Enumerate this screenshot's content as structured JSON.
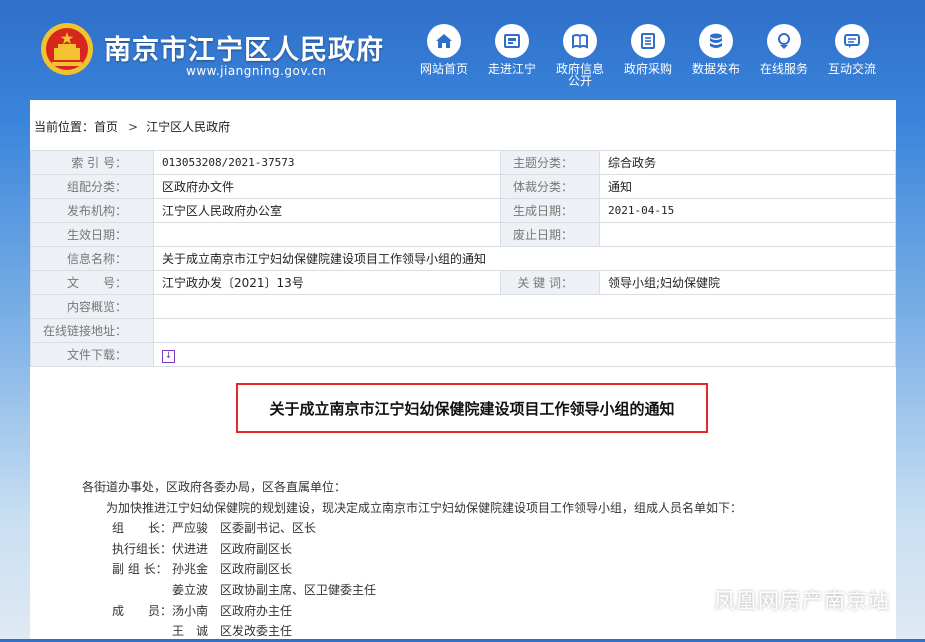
{
  "header": {
    "site_title": "南京市江宁区人民政府",
    "site_url": "www.jiangning.gov.cn",
    "nav": [
      {
        "label": "网站首页",
        "icon": "home-icon"
      },
      {
        "label": "走进江宁",
        "icon": "building-icon"
      },
      {
        "label": "政府信息公开",
        "icon": "book-icon"
      },
      {
        "label": "政府采购",
        "icon": "list-icon"
      },
      {
        "label": "数据发布",
        "icon": "database-icon"
      },
      {
        "label": "在线服务",
        "icon": "service-icon"
      },
      {
        "label": "互动交流",
        "icon": "chat-icon"
      }
    ]
  },
  "breadcrumb": {
    "prefix": "当前位置：",
    "home": "首页",
    "separator": ">",
    "current": "江宁区人民政府"
  },
  "meta": {
    "index_label": "索 引 号：",
    "index_value": "013053208/2021-37573",
    "topic_label": "主题分类：",
    "topic_value": "综合政务",
    "group_label": "组配分类：",
    "group_value": "区政府办文件",
    "genre_label": "体裁分类：",
    "genre_value": "通知",
    "issuer_label": "发布机构：",
    "issuer_value": "江宁区人民政府办公室",
    "date_label": "生成日期：",
    "date_value": "2021-04-15",
    "effective_label": "生效日期：",
    "effective_value": "",
    "abolish_label": "废止日期：",
    "abolish_value": "",
    "name_label": "信息名称：",
    "name_value": "关于成立南京市江宁妇幼保健院建设项目工作领导小组的通知",
    "docno_label": "文　　号：",
    "docno_value": "江宁政办发〔2021〕13号",
    "keyword_label": "关 键 词：",
    "keyword_value": "领导小组;妇幼保健院",
    "summary_label": "内容概览：",
    "summary_value": "",
    "link_label": "在线链接地址：",
    "link_value": "",
    "download_label": "文件下载：",
    "download_icon": "download-icon"
  },
  "notice": {
    "title": "关于成立南京市江宁妇幼保健院建设项目工作领导小组的通知",
    "salutation": "各街道办事处，区政府各委办局，区各直属单位：",
    "intro": "为加快推进江宁妇幼保健院的规划建设，现决定成立南京市江宁妇幼保健院建设项目工作领导小组，组成人员名单如下：",
    "members": [
      {
        "role": "组　　长：",
        "name": "严应骏　区委副书记、区长"
      },
      {
        "role": "执行组长：",
        "name": "伏进进　区政府副区长"
      },
      {
        "role": "副 组 长：",
        "name": "孙兆金　区政府副区长"
      },
      {
        "role": "",
        "name": "姜立波　区政协副主席、区卫健委主任"
      },
      {
        "role": "成　　员：",
        "name": "汤小南　区政府办主任"
      },
      {
        "role": "",
        "name": "王　诚　区发改委主任"
      }
    ]
  },
  "watermark": {
    "text": "凤凰网房产南京站",
    "icon": "wechat-icon"
  },
  "colors": {
    "header_blue": "#2f6fc9",
    "highlight_red": "#e32a2a",
    "label_bg": "#edf0f5"
  }
}
